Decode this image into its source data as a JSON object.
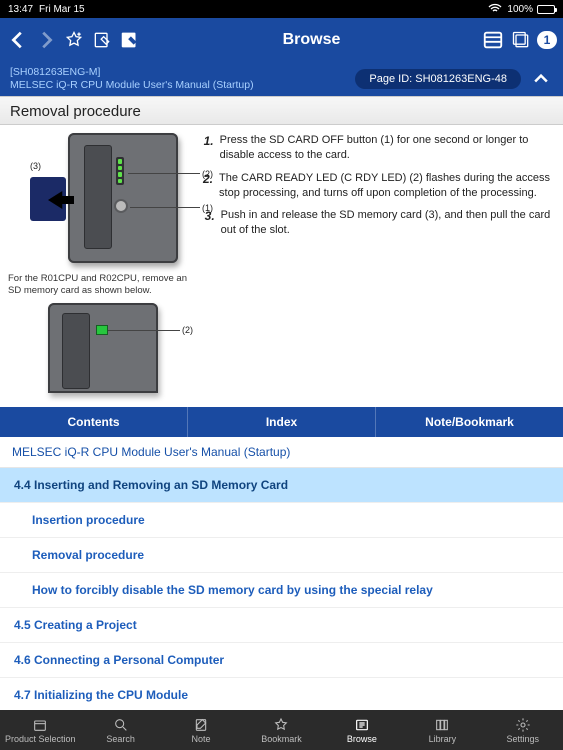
{
  "status": {
    "time": "13:47",
    "date": "Fri Mar 15",
    "battery": "100%"
  },
  "navbar": {
    "title": "Browse",
    "badge": "1"
  },
  "docinfo": {
    "doc_id": "[SH081263ENG-M]",
    "doc_title": "MELSEC iQ-R CPU Module User's Manual (Startup)",
    "page_id": "Page ID: SH081263ENG-48"
  },
  "section": {
    "title": "Removal procedure"
  },
  "figure": {
    "labels": {
      "l1": "(1)",
      "l2": "(2)",
      "l3": "(3)"
    },
    "note": "For the R01CPU and R02CPU, remove an SD memory card as shown below.",
    "label2": "(2)"
  },
  "steps": [
    {
      "num": "1.",
      "text": "Press the SD CARD OFF button (1) for one second or longer to disable access to the card."
    },
    {
      "num": "2.",
      "text": "The CARD READY LED (C RDY LED) (2) flashes during the access stop processing, and turns off upon completion of the processing."
    },
    {
      "num": "3.",
      "text": "Push in and release the SD memory card (3), and then pull the card out of the slot."
    }
  ],
  "tabs": {
    "contents": "Contents",
    "index": "Index",
    "bookmark": "Note/Bookmark"
  },
  "toc": {
    "title": "MELSEC iQ-R CPU Module User's Manual (Startup)",
    "items": [
      {
        "label": "4.4 Inserting and Removing an SD Memory Card",
        "cls": "selected"
      },
      {
        "label": "Insertion procedure",
        "cls": "sub"
      },
      {
        "label": "Removal procedure",
        "cls": "sub"
      },
      {
        "label": "How to forcibly disable the SD memory card by using the special relay",
        "cls": "sub"
      },
      {
        "label": "4.5 Creating a Project",
        "cls": ""
      },
      {
        "label": "4.6 Connecting a Personal Computer",
        "cls": ""
      },
      {
        "label": "4.7 Initializing the CPU Module",
        "cls": ""
      }
    ]
  },
  "bottombar": {
    "items": [
      "Product Selection",
      "Search",
      "Note",
      "Bookmark",
      "Browse",
      "Library",
      "Settings"
    ]
  }
}
